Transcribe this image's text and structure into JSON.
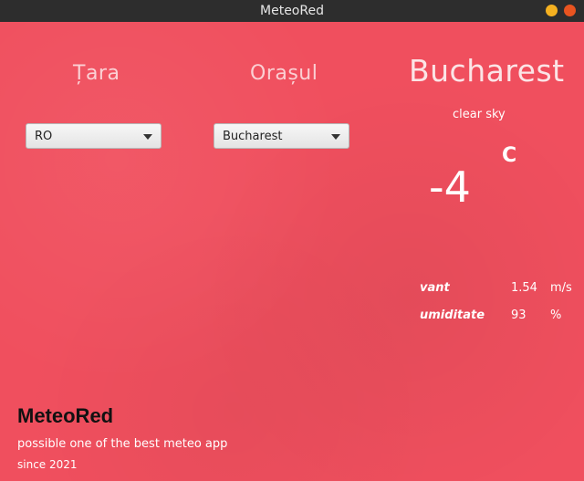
{
  "window": {
    "title": "MeteoRed"
  },
  "headings": {
    "country": "Țara",
    "city": "Orașul"
  },
  "selects": {
    "country": {
      "value": "RO"
    },
    "city": {
      "value": "Bucharest"
    }
  },
  "weather": {
    "city": "Bucharest",
    "description": "clear sky",
    "temperature": "-4",
    "unit": "C",
    "wind_label": "vant",
    "wind_value": "1.54",
    "wind_unit": "m/s",
    "humidity_label": "umiditate",
    "humidity_value": "93",
    "humidity_unit": "%"
  },
  "footer": {
    "brand": "MeteoRed",
    "tagline": "possible one of the best meteo app",
    "since": "since 2021"
  },
  "colors": {
    "background": "#f04f5e",
    "titlebar": "#2d2d2d",
    "minimize": "#f5b120",
    "close": "#e95420"
  }
}
